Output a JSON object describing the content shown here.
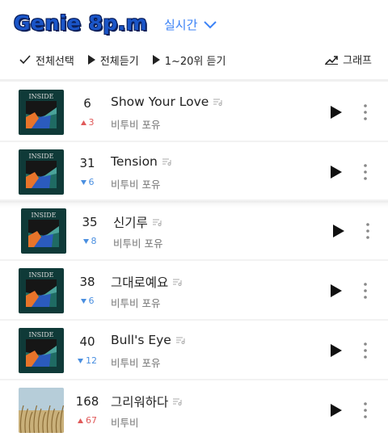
{
  "header": {
    "title": "Genie 8p.m",
    "filter_label": "실시간"
  },
  "actions": {
    "select_all": "전체선택",
    "play_all": "전체듣기",
    "play_top20": "1~20위 듣기",
    "graph": "그래프"
  },
  "songs": [
    {
      "rank": "6",
      "change": "3",
      "direction": "up",
      "title": "Show Your Love",
      "artist": "비투비 포유",
      "album_text": "INSIDE",
      "album_style": "inside"
    },
    {
      "rank": "31",
      "change": "6",
      "direction": "down",
      "title": "Tension",
      "artist": "비투비 포유",
      "album_text": "INSIDE",
      "album_style": "inside"
    },
    {
      "rank": "35",
      "change": "8",
      "direction": "down",
      "title": "신기루",
      "artist": "비투비 포유",
      "album_text": "INSIDE",
      "album_style": "inside"
    },
    {
      "rank": "38",
      "change": "6",
      "direction": "down",
      "title": "그대로예요",
      "artist": "비투비 포유",
      "album_text": "INSIDE",
      "album_style": "inside"
    },
    {
      "rank": "40",
      "change": "12",
      "direction": "down",
      "title": "Bull's Eye",
      "artist": "비투비 포유",
      "album_text": "INSIDE",
      "album_style": "inside"
    },
    {
      "rank": "168",
      "change": "67",
      "direction": "up",
      "title": "그리워하다",
      "artist": "비투비",
      "album_text": "",
      "album_style": "field"
    }
  ],
  "icons": {
    "check": "check-icon",
    "play": "play-icon",
    "graph": "trend-graph-icon",
    "more": "more-vertical-icon",
    "lyrics": "lyrics-icon",
    "chevron": "chevron-down-icon"
  },
  "colors": {
    "accent_blue": "#3b82f6",
    "rank_up": "#e05a5a",
    "rank_down": "#4a8fe0",
    "banner_fill": "#1a55c8",
    "banner_outline": "#0b1f5a"
  }
}
